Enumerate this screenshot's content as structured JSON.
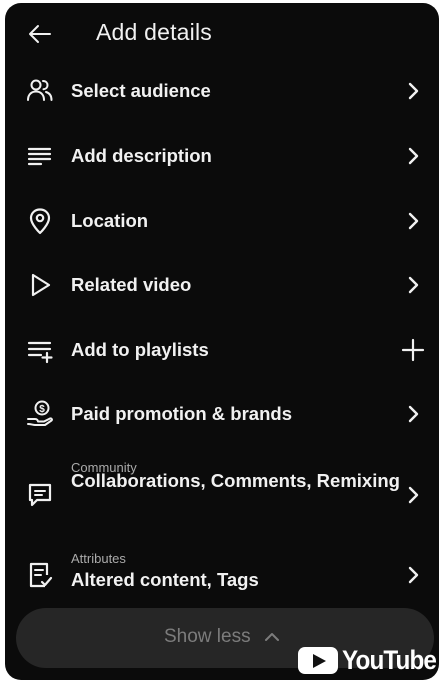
{
  "header": {
    "title": "Add details",
    "back_icon": "arrow-left-icon"
  },
  "items": [
    {
      "id": "select-audience",
      "label": "Select audience",
      "icon": "people-icon",
      "trail": "chevron-right-icon"
    },
    {
      "id": "add-description",
      "label": "Add description",
      "icon": "text-lines-icon",
      "trail": "chevron-right-icon"
    },
    {
      "id": "location",
      "label": "Location",
      "icon": "location-pin-icon",
      "trail": "chevron-right-icon"
    },
    {
      "id": "related-video",
      "label": "Related video",
      "icon": "play-outline-icon",
      "trail": "chevron-right-icon"
    },
    {
      "id": "add-to-playlists",
      "label": "Add to playlists",
      "icon": "playlist-add-icon",
      "trail": "plus-icon"
    },
    {
      "id": "paid-promotion",
      "label": "Paid promotion & brands",
      "icon": "money-hand-icon",
      "trail": "chevron-right-icon"
    },
    {
      "id": "community",
      "category": "Community",
      "label": "Collaborations, Comments, Remixing",
      "icon": "comment-icon",
      "trail": "chevron-right-icon"
    },
    {
      "id": "attributes",
      "category": "Attributes",
      "label": "Altered content, Tags",
      "icon": "checklist-doc-icon",
      "trail": "chevron-right-icon"
    }
  ],
  "footer": {
    "show_less_label": "Show less",
    "show_less_icon": "chevron-up-icon"
  },
  "watermark": {
    "text": "YouTube"
  },
  "colors": {
    "background": "#0b0b0b",
    "text": "#f1f1f1",
    "secondary_text": "#aaaaaa",
    "bar": "#262626"
  }
}
